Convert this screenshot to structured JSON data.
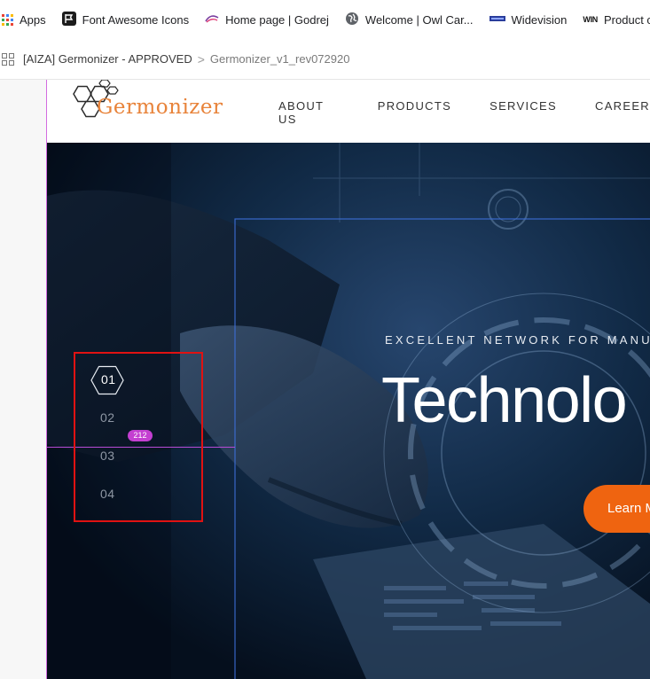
{
  "bookmarks": [
    {
      "label": "Apps",
      "icon": "apps-grid-icon"
    },
    {
      "label": "Font Awesome Icons",
      "icon": "flag-icon"
    },
    {
      "label": "Home page | Godrej",
      "icon": "godrej-logo-icon"
    },
    {
      "label": "Welcome | Owl Car...",
      "icon": "globe-icon"
    },
    {
      "label": "Widevision",
      "icon": "widevision-logo-icon"
    },
    {
      "label": "Product categorie",
      "icon": "win-logo-icon"
    }
  ],
  "breadcrumb": {
    "project": "[AIZA] Germonizer - APPROVED",
    "separator": ">",
    "page": "Germonizer_v1_rev072920"
  },
  "site": {
    "logo_text": "Germonizer",
    "nav": [
      "ABOUT US",
      "PRODUCTS",
      "SERVICES",
      "CAREER"
    ]
  },
  "hero": {
    "eyebrow": "EXCELLENT NETWORK FOR MANU",
    "headline": "Technolo",
    "cta_label": "Learn M",
    "slides": [
      "01",
      "02",
      "03",
      "04"
    ],
    "dimension_badge": "212"
  },
  "colors": {
    "accent_orange": "#ef6410",
    "logo_orange": "#e8833a",
    "selection_red": "#e01212",
    "guide_magenta": "#c43fd1",
    "hero_dark": "#061424"
  },
  "win_icon_text": "WIN"
}
